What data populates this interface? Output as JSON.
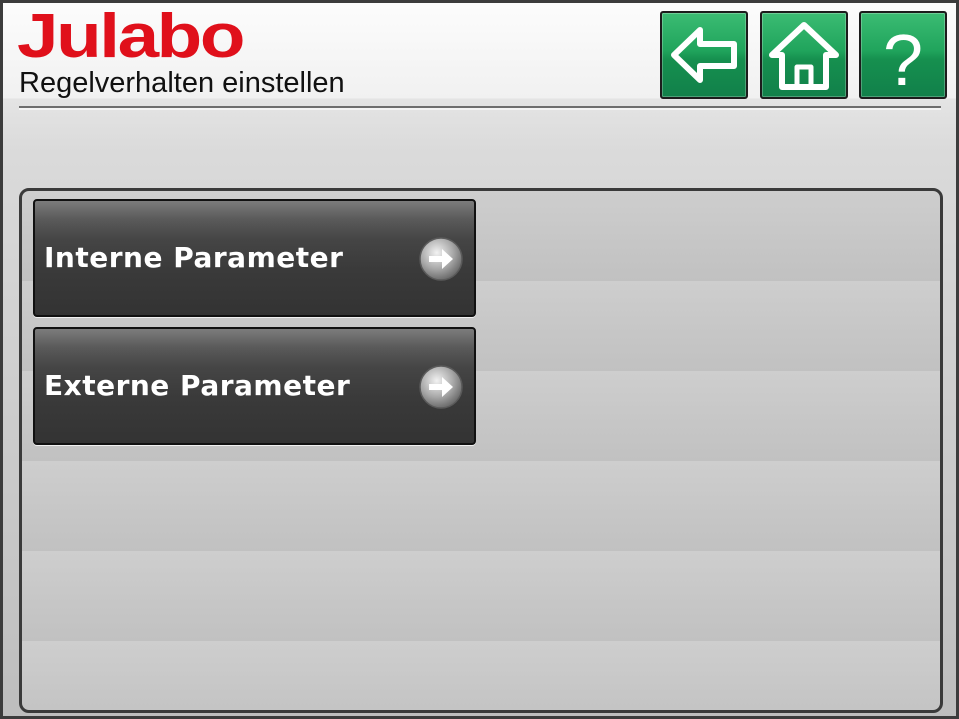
{
  "header": {
    "logo_text": "Julabo",
    "title": "Regelverhalten einstellen"
  },
  "nav": {
    "back": {
      "icon": "back-arrow-icon"
    },
    "home": {
      "icon": "home-icon"
    },
    "help": {
      "icon": "help-icon",
      "label": "?"
    }
  },
  "menu": {
    "items": [
      {
        "label": "Interne Parameter",
        "icon": "arrow-right-circle-icon"
      },
      {
        "label": "Externe Parameter",
        "icon": "arrow-right-circle-icon"
      }
    ]
  },
  "colors": {
    "brand_red": "#e0101b",
    "button_green": "#1e9e58",
    "menu_button_dark": "#3a3a3a"
  }
}
